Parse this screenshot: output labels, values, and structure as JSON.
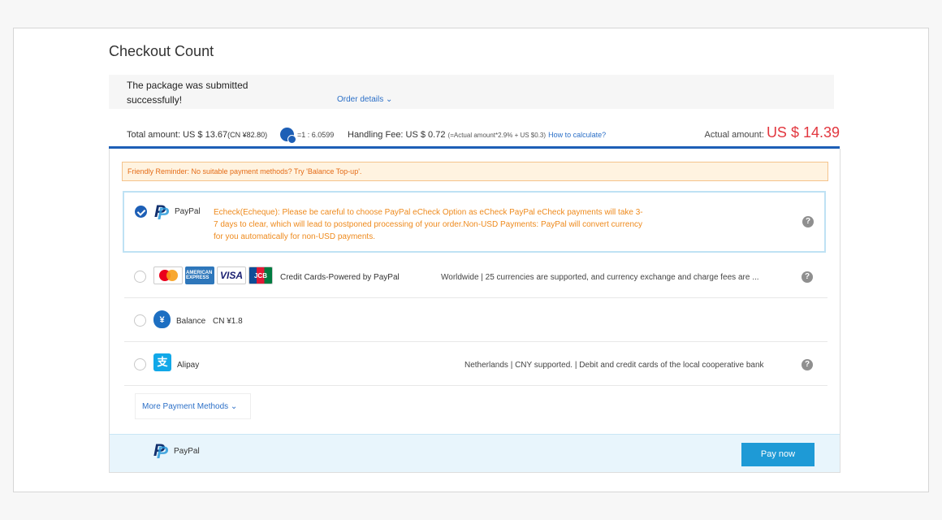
{
  "page": {
    "title": "Checkout Count"
  },
  "order": {
    "message": "The package was submitted successfully!",
    "details_link": "Order details ⌄"
  },
  "summary": {
    "total_label": "Total amount: US $ 13.67",
    "total_cny": "(CN ¥82.80)",
    "rate": "=1 : 6.0599",
    "handling_fee": "Handling Fee: US $ 0.72",
    "fee_formula": "(=Actual amount*2.9% + US $0.3)",
    "how_link": "How to calculate?",
    "actual_label": "Actual amount: ",
    "actual_value": "US $ 14.39"
  },
  "reminder": "Friendly Reminder: No suitable payment methods? Try 'Balance Top-up'.",
  "payment_methods": [
    {
      "name": "PayPal",
      "selected": true,
      "note": "Echeck(Echeque): Please be careful to choose PayPal eCheck Option as eCheck PayPal eCheck payments will take 3-7 days to clear, which will lead to postponed processing of your order.Non-USD Payments: PayPal will convert currency for you automatically for non-USD payments."
    },
    {
      "name": "Credit Cards-Powered by PayPal",
      "selected": false,
      "description": "Worldwide | 25 currencies are supported, and currency exchange and charge fees are ...",
      "card_visa": "VISA",
      "card_jcb": "JCB",
      "card_amex": "AMERICAN EXPRESS"
    },
    {
      "name": "Balance",
      "selected": false,
      "amount": "CN ¥1.8"
    },
    {
      "name": "Alipay",
      "selected": false,
      "description": "Netherlands | CNY supported. | Debit and credit cards of the local cooperative bank"
    }
  ],
  "more_methods": "More Payment Methods ⌄",
  "footer": {
    "method": "PayPal",
    "pay_button": "Pay now"
  },
  "icons": {
    "help": "?",
    "balance": "¥",
    "alipay": "支"
  }
}
